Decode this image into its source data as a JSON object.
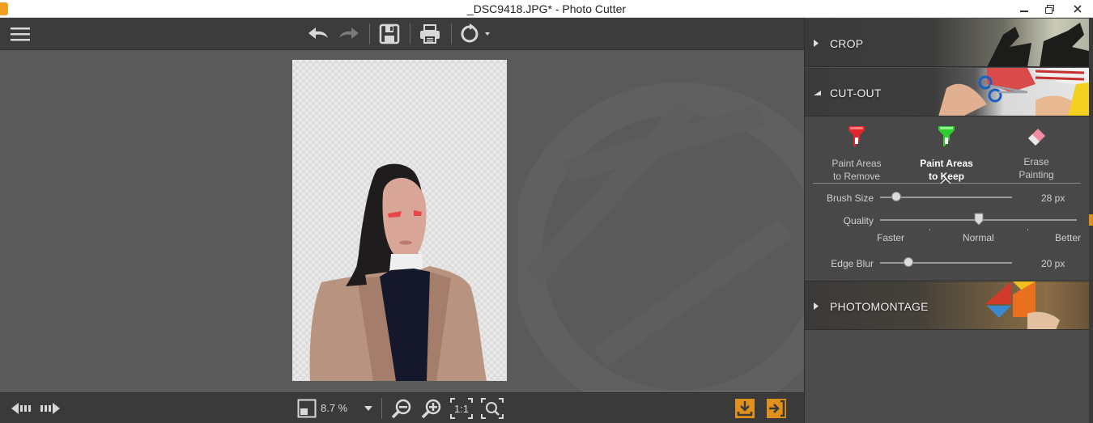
{
  "window": {
    "title": "_DSC9418.JPG* - Photo Cutter",
    "minimize_icon": "minimize-icon",
    "maximize_icon": "restore-icon",
    "close_icon": "close-icon"
  },
  "toolbar": {
    "icons": [
      "menu-icon",
      "undo-icon",
      "redo-icon",
      "save-icon",
      "print-icon",
      "rotate-icon",
      "dropdown-arrow-icon"
    ]
  },
  "canvas": {
    "image_description": "cut-out portrait on transparent checkerboard background"
  },
  "bottombar": {
    "zoom_value": "8.7 %",
    "icons": [
      "previous-image-icon",
      "next-image-icon",
      "zoom-fit-icon",
      "zoom-dropdown-icon",
      "zoom-out-icon",
      "zoom-in-icon",
      "zoom-1-1-icon",
      "zoom-fit-screen-icon",
      "save-export-icon",
      "exit-icon"
    ],
    "one_to_one": "1:1"
  },
  "panel": {
    "sections": {
      "crop": "CROP",
      "cutout": "CUT-OUT",
      "photomontage": "PHOTOMONTAGE"
    },
    "tools": [
      {
        "label": "Paint Areas\nto Remove",
        "icon": "red-marker-icon",
        "color": "#e0262a"
      },
      {
        "label": "Paint Areas\nto Keep",
        "icon": "green-marker-icon",
        "color": "#2ecc2e",
        "active": true
      },
      {
        "label": "Erase\nPainting",
        "icon": "eraser-icon",
        "color": "#f28ba0"
      }
    ],
    "brush_size": {
      "label": "Brush Size",
      "value": "28 px",
      "level": 0.05
    },
    "quality": {
      "label": "Quality",
      "level": 0.5,
      "scale": [
        "Faster",
        "Normal",
        "Better"
      ]
    },
    "edge_blur": {
      "label": "Edge Blur",
      "value": "20 px",
      "level": 0.22
    }
  },
  "colors": {
    "accent": "#e0901c",
    "panel_bg": "#484848",
    "canvas_bg": "#5a5a5a"
  }
}
